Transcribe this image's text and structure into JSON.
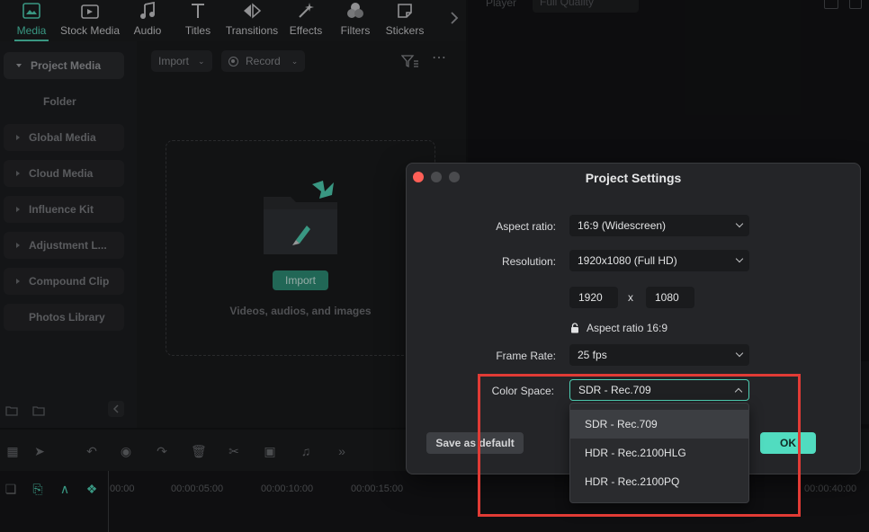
{
  "toolbar": {
    "items": [
      {
        "label": "Media",
        "icon": "media-icon",
        "active": true
      },
      {
        "label": "Stock Media",
        "icon": "stock-media-icon"
      },
      {
        "label": "Audio",
        "icon": "music-note-icon"
      },
      {
        "label": "Titles",
        "icon": "text-icon"
      },
      {
        "label": "Transitions",
        "icon": "transitions-icon"
      },
      {
        "label": "Effects",
        "icon": "effects-icon"
      },
      {
        "label": "Filters",
        "icon": "filters-icon"
      },
      {
        "label": "Stickers",
        "icon": "stickers-icon"
      }
    ]
  },
  "sidebar": {
    "items": [
      {
        "label": "Project Media"
      },
      {
        "label": "Folder"
      },
      {
        "label": "Global Media"
      },
      {
        "label": "Cloud Media"
      },
      {
        "label": "Influence Kit"
      },
      {
        "label": "Adjustment L..."
      },
      {
        "label": "Compound Clip"
      },
      {
        "label": "Photos Library"
      }
    ]
  },
  "media": {
    "import_label": "Import",
    "record_label": "Record",
    "import_button": "Import",
    "hint": "Videos, audios, and images"
  },
  "player": {
    "label": "Player",
    "quality": "Full Quality"
  },
  "timeline": {
    "ticks": [
      "00:00",
      "00:00:05:00",
      "00:00:10:00",
      "00:00:15:00",
      "00:00:40:00"
    ]
  },
  "dialog": {
    "title": "Project Settings",
    "aspect_label": "Aspect ratio:",
    "aspect_value": "16:9 (Widescreen)",
    "resolution_label": "Resolution:",
    "resolution_value": "1920x1080 (Full HD)",
    "width": "1920",
    "by": "x",
    "height": "1080",
    "aspect_lock": "Aspect ratio 16:9",
    "frame_rate_label": "Frame Rate:",
    "frame_rate_value": "25 fps",
    "color_space_label": "Color Space:",
    "color_space_value": "SDR - Rec.709",
    "save_default": "Save as default",
    "ok": "OK",
    "color_space_options": [
      "SDR - Rec.709",
      "HDR - Rec.2100HLG",
      "HDR - Rec.2100PQ"
    ]
  },
  "colors": {
    "accent": "#4fd1b5",
    "highlight_box": "#e13b35",
    "ok_button": "#51dcc0"
  }
}
